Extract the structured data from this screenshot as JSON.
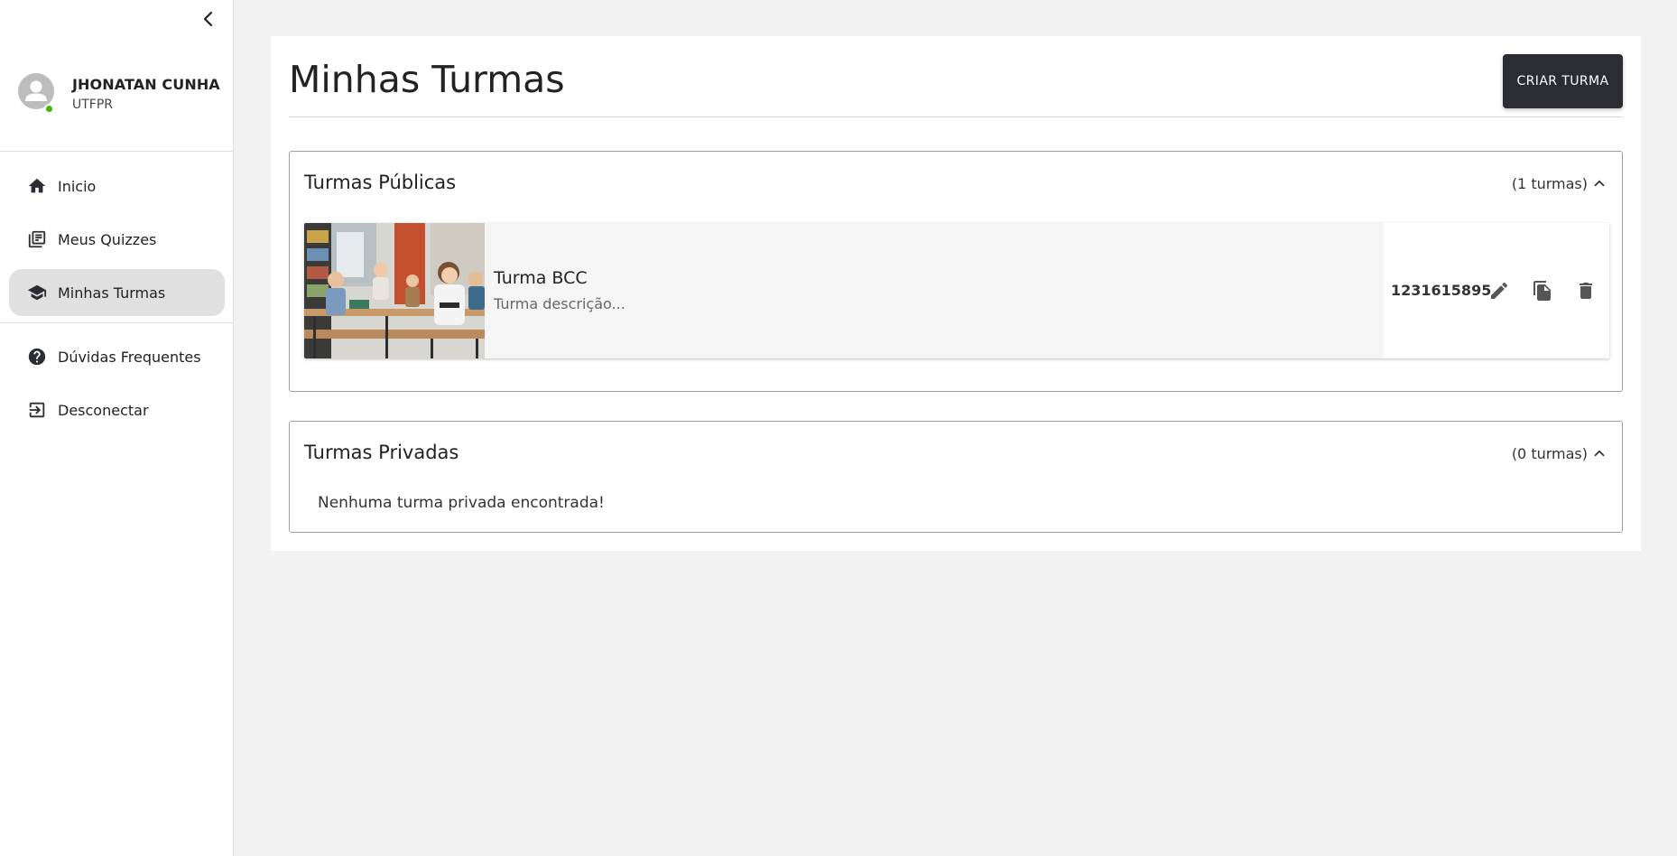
{
  "sidebar": {
    "user": {
      "name": "JHONATAN CUNHA",
      "org": "UTFPR"
    },
    "items": [
      {
        "label": "Inicio",
        "icon": "home-icon"
      },
      {
        "label": "Meus Quizzes",
        "icon": "library-books-icon"
      },
      {
        "label": "Minhas Turmas",
        "icon": "school-icon",
        "active": true
      },
      {
        "label": "Dúvidas Frequentes",
        "icon": "help-circle-icon"
      },
      {
        "label": "Desconectar",
        "icon": "logout-icon"
      }
    ]
  },
  "main": {
    "title": "Minhas Turmas",
    "create_button": "CRIAR TURMA",
    "public_section": {
      "title": "Turmas Públicas",
      "count": "(1 turmas)",
      "cards": [
        {
          "title": "Turma BCC",
          "description": "Turma descrição...",
          "code": "1231615895"
        }
      ]
    },
    "private_section": {
      "title": "Turmas Privadas",
      "count": "(0 turmas)",
      "empty_message": "Nenhuma turma privada encontrada!"
    }
  },
  "colors": {
    "background": "#f2f2f2",
    "active_nav": "#e0e0e0",
    "button_dark": "#2b2d33",
    "online_status": "#44b700"
  }
}
